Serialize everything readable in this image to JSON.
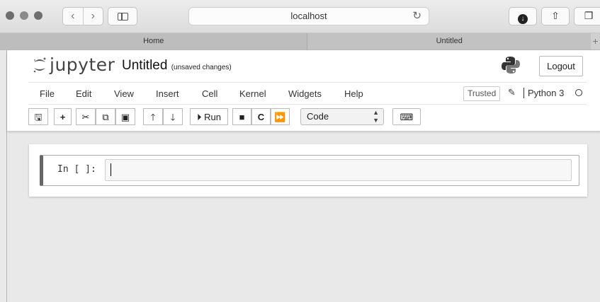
{
  "browser": {
    "url": "localhost",
    "tabs": [
      {
        "label": "Home"
      },
      {
        "label": "Untitled"
      }
    ]
  },
  "header": {
    "logo_text": "jupyter",
    "notebook_title": "Untitled",
    "save_status": "(unsaved changes)",
    "logout_label": "Logout"
  },
  "menu": {
    "items": [
      "File",
      "Edit",
      "View",
      "Insert",
      "Cell",
      "Kernel",
      "Widgets",
      "Help"
    ],
    "trusted_label": "Trusted",
    "kernel_name": "Python 3"
  },
  "toolbar": {
    "run_label": "Run",
    "cell_type": "Code"
  },
  "cell": {
    "prompt": "In [ ]:",
    "source": ""
  }
}
